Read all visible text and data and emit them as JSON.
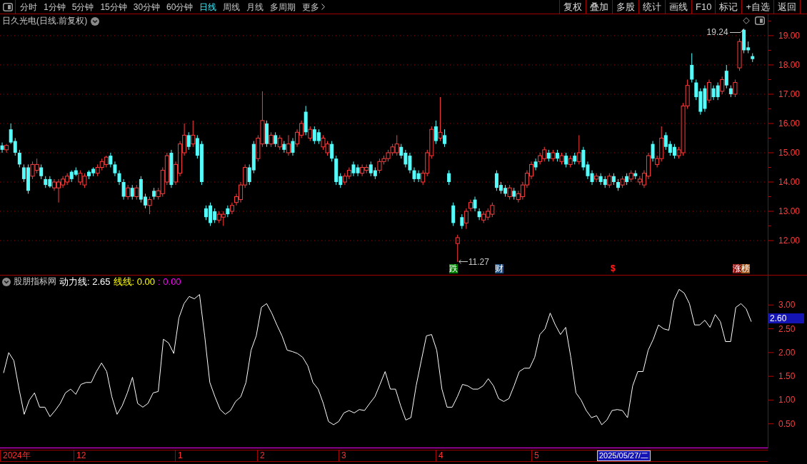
{
  "toolbar": {
    "periods": [
      {
        "label": "分时",
        "selected": false
      },
      {
        "label": "1分钟",
        "selected": false
      },
      {
        "label": "5分钟",
        "selected": false
      },
      {
        "label": "15分钟",
        "selected": false
      },
      {
        "label": "30分钟",
        "selected": false
      },
      {
        "label": "60分钟",
        "selected": false
      },
      {
        "label": "日线",
        "selected": true
      },
      {
        "label": "周线",
        "selected": false
      },
      {
        "label": "月线",
        "selected": false
      },
      {
        "label": "多周期",
        "selected": false
      }
    ],
    "more": "更多",
    "actions": [
      "复权",
      "叠加",
      "多股",
      "统计",
      "画线",
      "F10",
      "标记",
      "+自选",
      "返回"
    ]
  },
  "price_panel": {
    "title": "日久光电(日线.前复权)",
    "high_label": "19.24",
    "low_label": "11.27",
    "event_tags": [
      {
        "label": "跌",
        "kind": "tag",
        "color": "#008000"
      },
      {
        "label": "财",
        "kind": "tag",
        "color": "#1c4f86"
      },
      {
        "label": "$",
        "kind": "symbol",
        "color": "#ff2020"
      },
      {
        "label": "涨",
        "kind": "tag",
        "color": "#8c1010"
      },
      {
        "label": "榜",
        "kind": "tag",
        "color": "#a85a1c"
      }
    ],
    "chart_data": {
      "type": "candlestick",
      "grid": true,
      "ylim": [
        10.83,
        19.73
      ],
      "yticks": [
        {
          "value": 19,
          "label": "19.00"
        },
        {
          "value": 18,
          "label": "18.00"
        },
        {
          "value": 17,
          "label": "17.00"
        },
        {
          "value": 16,
          "label": "16.00"
        },
        {
          "value": 15,
          "label": "15.00"
        },
        {
          "value": 14,
          "label": "14.00"
        },
        {
          "value": 13,
          "label": "13.00"
        },
        {
          "value": 12,
          "label": "12.00"
        }
      ],
      "ohlc": [
        [
          15.25,
          15.35,
          15.0,
          15.1
        ],
        [
          15.1,
          15.3,
          15.0,
          15.25
        ],
        [
          15.8,
          16.0,
          15.3,
          15.35
        ],
        [
          15.4,
          15.5,
          14.9,
          15.0
        ],
        [
          15.0,
          15.1,
          14.5,
          14.6
        ],
        [
          14.5,
          14.6,
          14.0,
          14.1
        ],
        [
          14.5,
          14.6,
          13.6,
          13.7
        ],
        [
          14.2,
          14.7,
          14.1,
          14.6
        ],
        [
          14.4,
          14.8,
          14.3,
          14.6
        ],
        [
          14.5,
          14.6,
          14.1,
          14.2
        ],
        [
          14.1,
          14.2,
          13.8,
          13.9
        ],
        [
          14.1,
          14.2,
          13.8,
          13.85
        ],
        [
          13.8,
          14.1,
          13.7,
          14.0
        ],
        [
          13.8,
          14.1,
          13.3,
          14.0
        ],
        [
          13.9,
          14.2,
          13.8,
          14.1
        ],
        [
          14.0,
          14.3,
          13.9,
          14.2
        ],
        [
          14.35,
          14.4,
          14.0,
          14.1
        ],
        [
          14.4,
          14.5,
          14.2,
          14.25
        ],
        [
          14.0,
          14.4,
          13.9,
          14.3
        ],
        [
          13.9,
          14.3,
          13.8,
          14.2
        ],
        [
          14.35,
          14.4,
          14.1,
          14.2
        ],
        [
          14.45,
          14.5,
          14.2,
          14.3
        ],
        [
          14.3,
          14.6,
          14.2,
          14.5
        ],
        [
          14.5,
          14.8,
          14.4,
          14.7
        ],
        [
          14.6,
          14.9,
          14.5,
          14.85
        ],
        [
          14.9,
          15.0,
          14.5,
          14.6
        ],
        [
          14.6,
          14.7,
          14.2,
          14.3
        ],
        [
          14.3,
          14.4,
          13.9,
          14.0
        ],
        [
          14.0,
          14.1,
          13.4,
          13.5
        ],
        [
          13.5,
          13.9,
          13.4,
          13.8
        ],
        [
          13.8,
          13.9,
          13.4,
          13.5
        ],
        [
          13.5,
          13.9,
          13.4,
          13.8
        ],
        [
          14.1,
          14.2,
          13.3,
          13.4
        ],
        [
          13.5,
          13.6,
          13.1,
          13.2
        ],
        [
          13.2,
          13.5,
          12.9,
          13.4
        ],
        [
          13.7,
          13.8,
          13.4,
          13.5
        ],
        [
          13.5,
          13.8,
          13.4,
          13.7
        ],
        [
          13.6,
          14.5,
          13.5,
          14.4
        ],
        [
          14.0,
          15.0,
          13.9,
          14.9
        ],
        [
          15.0,
          15.1,
          13.8,
          13.9
        ],
        [
          14.0,
          14.7,
          13.9,
          14.6
        ],
        [
          14.3,
          15.4,
          14.2,
          15.3
        ],
        [
          15.0,
          16.0,
          14.9,
          15.6
        ],
        [
          15.6,
          15.7,
          15.1,
          15.2
        ],
        [
          15.3,
          16.1,
          15.2,
          15.6
        ],
        [
          15.5,
          15.6,
          14.8,
          14.9
        ],
        [
          15.3,
          15.4,
          13.9,
          14.0
        ],
        [
          13.1,
          13.2,
          12.7,
          12.8
        ],
        [
          13.2,
          13.3,
          12.5,
          12.6
        ],
        [
          13.0,
          13.1,
          12.6,
          12.7
        ],
        [
          12.7,
          13.0,
          12.6,
          12.9
        ],
        [
          12.8,
          13.0,
          12.5,
          12.9
        ],
        [
          13.1,
          13.2,
          12.8,
          12.9
        ],
        [
          13.0,
          13.3,
          12.9,
          13.2
        ],
        [
          13.3,
          13.6,
          13.2,
          13.5
        ],
        [
          13.4,
          14.0,
          13.3,
          13.9
        ],
        [
          13.9,
          14.6,
          13.8,
          14.5
        ],
        [
          14.5,
          14.6,
          13.9,
          14.0
        ],
        [
          15.3,
          15.4,
          14.3,
          14.4
        ],
        [
          14.8,
          15.6,
          14.7,
          15.5
        ],
        [
          15.3,
          17.1,
          15.2,
          16.1
        ],
        [
          16.0,
          16.1,
          15.2,
          15.3
        ],
        [
          15.3,
          15.7,
          15.2,
          15.6
        ],
        [
          15.6,
          15.7,
          15.2,
          15.3
        ],
        [
          15.2,
          15.6,
          15.1,
          15.5
        ],
        [
          15.3,
          15.4,
          15.0,
          15.1
        ],
        [
          15.0,
          15.6,
          14.9,
          15.3
        ],
        [
          15.4,
          15.5,
          14.9,
          15.0
        ],
        [
          15.3,
          15.8,
          15.2,
          15.7
        ],
        [
          15.6,
          16.1,
          15.5,
          16.0
        ],
        [
          16.4,
          16.6,
          15.6,
          15.7
        ],
        [
          15.5,
          15.9,
          15.4,
          15.8
        ],
        [
          15.8,
          15.9,
          15.3,
          15.4
        ],
        [
          15.7,
          15.8,
          15.3,
          15.4
        ],
        [
          15.2,
          15.6,
          15.1,
          15.5
        ],
        [
          15.0,
          15.4,
          14.9,
          15.3
        ],
        [
          15.3,
          15.4,
          14.7,
          14.8
        ],
        [
          14.8,
          14.9,
          13.9,
          14.0
        ],
        [
          14.2,
          14.3,
          13.8,
          13.9
        ],
        [
          14.0,
          14.3,
          13.9,
          14.2
        ],
        [
          14.2,
          14.5,
          14.1,
          14.4
        ],
        [
          14.6,
          14.7,
          14.2,
          14.3
        ],
        [
          14.5,
          14.6,
          14.2,
          14.3
        ],
        [
          14.3,
          14.6,
          14.2,
          14.5
        ],
        [
          14.4,
          14.6,
          14.3,
          14.5
        ],
        [
          14.6,
          14.7,
          14.2,
          14.3
        ],
        [
          14.4,
          14.5,
          14.1,
          14.2
        ],
        [
          14.4,
          14.8,
          14.3,
          14.7
        ],
        [
          14.7,
          14.9,
          14.6,
          14.8
        ],
        [
          14.8,
          15.1,
          14.7,
          15.0
        ],
        [
          15.0,
          15.3,
          14.9,
          15.2
        ],
        [
          15.0,
          15.6,
          14.9,
          15.3
        ],
        [
          15.2,
          15.3,
          14.8,
          14.9
        ],
        [
          15.0,
          15.1,
          14.5,
          14.6
        ],
        [
          14.9,
          15.0,
          14.3,
          14.4
        ],
        [
          14.4,
          14.5,
          14.0,
          14.1
        ],
        [
          14.3,
          14.4,
          14.0,
          14.1
        ],
        [
          14.0,
          14.4,
          13.9,
          14.3
        ],
        [
          14.3,
          15.1,
          14.2,
          15.0
        ],
        [
          14.9,
          15.9,
          14.8,
          15.8
        ],
        [
          15.9,
          16.1,
          15.3,
          15.4
        ],
        [
          15.5,
          16.9,
          15.4,
          15.7
        ],
        [
          15.6,
          15.8,
          15.2,
          15.3
        ],
        [
          14.3,
          14.4,
          13.9,
          14.0
        ],
        [
          13.2,
          13.3,
          12.5,
          12.6
        ],
        [
          11.9,
          12.2,
          11.27,
          12.1
        ],
        [
          12.8,
          12.9,
          12.4,
          12.5
        ],
        [
          12.6,
          13.1,
          12.4,
          13.0
        ],
        [
          13.1,
          13.4,
          13.0,
          13.3
        ],
        [
          13.4,
          13.5,
          13.0,
          13.1
        ],
        [
          13.0,
          13.1,
          12.7,
          12.8
        ],
        [
          12.7,
          13.0,
          12.6,
          12.9
        ],
        [
          12.8,
          13.1,
          12.7,
          13.0
        ],
        [
          12.9,
          13.3,
          12.8,
          13.2
        ],
        [
          14.3,
          14.4,
          13.7,
          13.8
        ],
        [
          13.9,
          14.0,
          13.6,
          13.7
        ],
        [
          13.8,
          13.9,
          13.5,
          13.6
        ],
        [
          13.5,
          13.9,
          13.4,
          13.8
        ],
        [
          13.7,
          13.8,
          13.4,
          13.5
        ],
        [
          13.4,
          13.7,
          13.3,
          13.6
        ],
        [
          13.5,
          14.0,
          13.4,
          13.9
        ],
        [
          13.9,
          14.4,
          13.8,
          14.3
        ],
        [
          14.2,
          14.7,
          14.1,
          14.6
        ],
        [
          14.7,
          14.8,
          14.4,
          14.5
        ],
        [
          14.7,
          15.0,
          14.6,
          14.9
        ],
        [
          14.8,
          15.2,
          14.7,
          15.1
        ],
        [
          15.0,
          15.1,
          14.7,
          14.8
        ],
        [
          14.8,
          15.1,
          14.7,
          15.0
        ],
        [
          15.0,
          15.1,
          14.7,
          14.8
        ],
        [
          14.7,
          15.0,
          14.6,
          14.9
        ],
        [
          14.9,
          15.0,
          14.5,
          14.6
        ],
        [
          14.6,
          14.9,
          14.5,
          14.8
        ],
        [
          14.9,
          15.0,
          14.6,
          14.7
        ],
        [
          14.7,
          15.6,
          14.6,
          15.0
        ],
        [
          15.1,
          15.2,
          14.4,
          14.5
        ],
        [
          14.6,
          14.7,
          14.1,
          14.2
        ],
        [
          14.3,
          14.4,
          13.9,
          14.0
        ],
        [
          14.1,
          14.3,
          14.0,
          14.2
        ],
        [
          14.2,
          14.3,
          13.9,
          14.0
        ],
        [
          14.1,
          14.2,
          13.8,
          13.9
        ],
        [
          13.9,
          14.3,
          13.8,
          14.2
        ],
        [
          14.2,
          14.3,
          13.9,
          14.0
        ],
        [
          14.0,
          14.1,
          13.7,
          13.8
        ],
        [
          13.9,
          14.2,
          13.8,
          14.1
        ],
        [
          14.2,
          14.3,
          13.9,
          14.0
        ],
        [
          14.1,
          14.4,
          14.0,
          14.3
        ],
        [
          14.3,
          14.4,
          14.1,
          14.2
        ],
        [
          14.0,
          14.2,
          13.9,
          14.1
        ],
        [
          13.9,
          14.4,
          13.8,
          14.3
        ],
        [
          14.2,
          15.0,
          14.1,
          14.9
        ],
        [
          15.3,
          15.4,
          14.7,
          14.8
        ],
        [
          14.6,
          14.9,
          14.5,
          14.8
        ],
        [
          14.8,
          15.9,
          14.7,
          15.5
        ],
        [
          15.6,
          15.7,
          15.1,
          15.2
        ],
        [
          15.3,
          15.4,
          14.9,
          15.0
        ],
        [
          15.2,
          15.3,
          14.8,
          14.9
        ],
        [
          14.9,
          15.2,
          14.8,
          15.1
        ],
        [
          15.0,
          16.7,
          14.9,
          16.6
        ],
        [
          16.6,
          17.5,
          16.5,
          17.3
        ],
        [
          18.0,
          18.4,
          17.4,
          17.5
        ],
        [
          17.4,
          17.5,
          16.8,
          16.9
        ],
        [
          17.1,
          17.2,
          16.3,
          16.4
        ],
        [
          17.2,
          17.3,
          16.4,
          16.5
        ],
        [
          16.8,
          17.5,
          16.7,
          17.4
        ],
        [
          17.2,
          17.3,
          16.8,
          16.9
        ],
        [
          17.3,
          17.4,
          16.8,
          16.9
        ],
        [
          17.1,
          17.6,
          17.0,
          17.5
        ],
        [
          17.8,
          18.0,
          17.2,
          17.3
        ],
        [
          17.2,
          17.3,
          16.9,
          17.0
        ],
        [
          17.0,
          17.5,
          16.9,
          17.4
        ],
        [
          17.9,
          18.9,
          17.8,
          18.8
        ],
        [
          19.2,
          19.24,
          18.4,
          18.5
        ],
        [
          18.6,
          18.8,
          18.4,
          18.5
        ],
        [
          18.3,
          18.4,
          18.1,
          18.2
        ],
        null,
        null,
        null
      ]
    }
  },
  "indicator_panel": {
    "name": "股朋指标网",
    "legend": [
      {
        "label": ": 2.65",
        "color": "#ffffff"
      },
      {
        "label": "线线: 0.00",
        "color": "#ffff00"
      },
      {
        "label": ": 0.00",
        "color": "#ff00ff"
      }
    ],
    "cursor_value": "2.60",
    "chart_data": {
      "type": "line",
      "ylim": [
        0,
        3.62
      ],
      "yticks": [
        {
          "value": 0.5,
          "label": "0.50"
        },
        {
          "value": 1,
          "label": "1.00"
        },
        {
          "value": 1.5,
          "label": "1.50"
        },
        {
          "value": 2,
          "label": "2.00"
        },
        {
          "value": 2.5,
          "label": "2.50"
        },
        {
          "value": 3,
          "label": "3.00"
        }
      ],
      "series": [
        {
          "name": "动力线",
          "color": "#ffffff",
          "values": [
            1.57,
            2.0,
            1.83,
            1.23,
            0.7,
            1.0,
            1.15,
            0.85,
            0.85,
            0.65,
            0.78,
            0.93,
            1.15,
            1.23,
            1.12,
            1.33,
            1.37,
            1.37,
            1.6,
            1.78,
            1.6,
            1.07,
            0.7,
            0.88,
            1.15,
            1.48,
            0.93,
            0.85,
            0.93,
            1.15,
            1.18,
            2.28,
            2.2,
            1.98,
            2.73,
            3.03,
            3.18,
            3.13,
            3.22,
            2.35,
            1.37,
            1.07,
            0.8,
            0.7,
            0.78,
            0.97,
            1.07,
            1.37,
            2.05,
            2.35,
            2.95,
            3.03,
            2.83,
            2.58,
            2.35,
            2.05,
            2.02,
            1.98,
            1.9,
            1.72,
            1.37,
            1.23,
            0.93,
            0.55,
            0.48,
            0.55,
            0.73,
            0.78,
            0.73,
            0.8,
            0.78,
            0.93,
            1.07,
            1.33,
            1.6,
            1.23,
            1.23,
            0.88,
            0.58,
            0.63,
            1.3,
            1.83,
            2.35,
            2.38,
            2.05,
            1.23,
            0.85,
            0.85,
            1.07,
            1.33,
            1.3,
            1.23,
            1.23,
            1.3,
            1.45,
            1.3,
            1.03,
            0.97,
            1.03,
            1.3,
            1.6,
            1.67,
            1.67,
            1.9,
            2.38,
            2.5,
            2.83,
            2.58,
            2.38,
            2.53,
            1.9,
            1.15,
            1.0,
            0.78,
            0.63,
            0.67,
            0.48,
            0.58,
            0.78,
            0.8,
            0.78,
            0.63,
            1.3,
            1.6,
            1.6,
            2.05,
            2.28,
            2.58,
            2.5,
            2.47,
            3.1,
            3.33,
            3.25,
            3.03,
            2.58,
            2.58,
            2.68,
            2.53,
            2.8,
            2.65,
            2.23,
            2.23,
            2.95,
            3.03,
            2.92,
            2.65
          ]
        }
      ]
    }
  },
  "time_axis": {
    "labels": [
      "2024年",
      "12",
      "1",
      "2",
      "3",
      "4",
      "5"
    ],
    "cursor_date": "2025/05/27/二"
  }
}
